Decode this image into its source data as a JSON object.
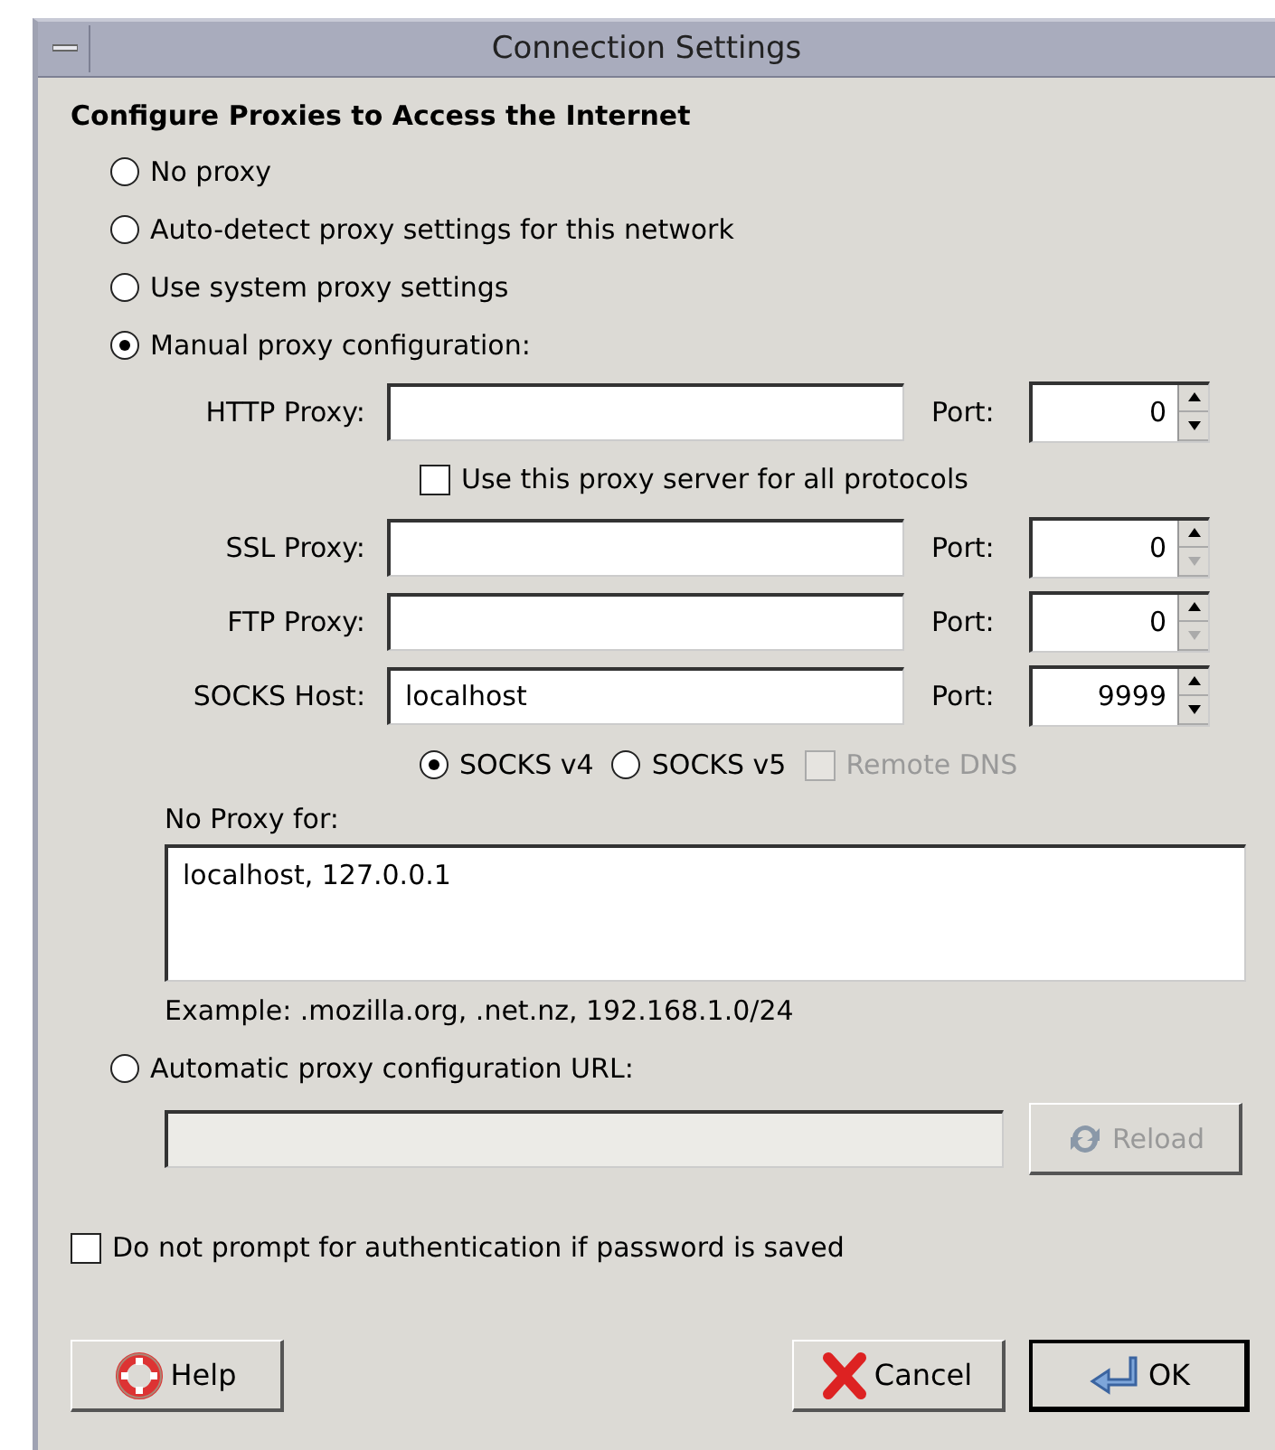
{
  "window": {
    "title": "Connection Settings"
  },
  "heading": "Configure Proxies to Access the Internet",
  "modes": [
    {
      "label": "No proxy",
      "selected": false
    },
    {
      "label": "Auto-detect proxy settings for this network",
      "selected": false
    },
    {
      "label": "Use system proxy settings",
      "selected": false
    },
    {
      "label": "Manual proxy configuration:",
      "selected": true
    }
  ],
  "proxies": [
    {
      "label": "HTTP Proxy:",
      "port_label": "Port:",
      "port": "0",
      "down_disabled": false
    },
    {
      "label": "SSL Proxy:",
      "port_label": "Port:",
      "port": "0",
      "down_disabled": true
    },
    {
      "label": "FTP Proxy:",
      "port_label": "Port:",
      "port": "0",
      "down_disabled": true
    },
    {
      "label": "SOCKS Host:",
      "value": "localhost",
      "port_label": "Port:",
      "port": "9999",
      "down_disabled": false
    }
  ],
  "share": {
    "label": "Use this proxy server for all protocols",
    "checked": false
  },
  "socks_versions": [
    {
      "label": "SOCKS v4",
      "selected": true
    },
    {
      "label": "SOCKS v5",
      "selected": false
    }
  ],
  "remote_dns": {
    "label": "Remote DNS",
    "checked": false,
    "disabled": true
  },
  "no_proxy": {
    "label": "No Proxy for:",
    "value": "localhost, 127.0.0.1",
    "example": "Example: .mozilla.org, .net.nz, 192.168.1.0/24"
  },
  "auto_url": {
    "label": "Automatic proxy configuration URL:",
    "selected": false,
    "disabled": true,
    "reload": "Reload"
  },
  "no_prompt": {
    "label": "Do not prompt for authentication if password is saved",
    "checked": false
  },
  "buttons": [
    {
      "kind": "help",
      "label": "Help"
    },
    {
      "kind": "cancel",
      "label": "Cancel"
    },
    {
      "kind": "ok",
      "label": "OK",
      "default": true
    }
  ]
}
